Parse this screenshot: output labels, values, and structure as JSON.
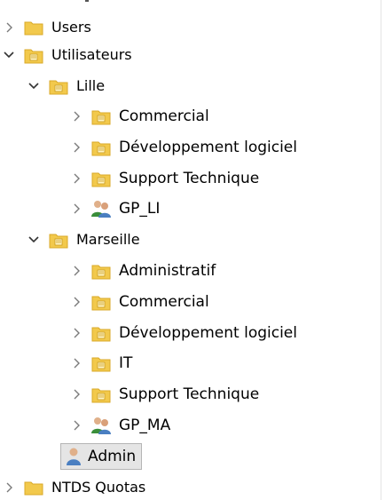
{
  "tree": {
    "items": [
      {
        "label": "Users",
        "expanded": false,
        "icon": "folder-icon",
        "level": 0
      },
      {
        "label": "Utilisateurs",
        "expanded": true,
        "icon": "ou-folder-icon",
        "level": 0
      },
      {
        "label": "Lille",
        "expanded": true,
        "icon": "ou-folder-icon",
        "level": 1
      },
      {
        "label": "Commercial",
        "expanded": false,
        "icon": "ou-folder-icon",
        "level": 2
      },
      {
        "label": "Développement logiciel",
        "expanded": false,
        "icon": "ou-folder-icon",
        "level": 2
      },
      {
        "label": "Support Technique",
        "expanded": false,
        "icon": "ou-folder-icon",
        "level": 2
      },
      {
        "label": "GP_LI",
        "expanded": false,
        "icon": "group-icon",
        "level": 2
      },
      {
        "label": "Marseille",
        "expanded": true,
        "icon": "ou-folder-icon",
        "level": 1
      },
      {
        "label": "Administratif",
        "expanded": false,
        "icon": "ou-folder-icon",
        "level": 2
      },
      {
        "label": "Commercial",
        "expanded": false,
        "icon": "ou-folder-icon",
        "level": 2
      },
      {
        "label": "Développement logiciel",
        "expanded": false,
        "icon": "ou-folder-icon",
        "level": 2
      },
      {
        "label": "IT",
        "expanded": false,
        "icon": "ou-folder-icon",
        "level": 2
      },
      {
        "label": "Support Technique",
        "expanded": false,
        "icon": "ou-folder-icon",
        "level": 2
      },
      {
        "label": "GP_MA",
        "expanded": false,
        "icon": "group-icon",
        "level": 2
      },
      {
        "label": "Admin",
        "expanded": null,
        "icon": "user-icon",
        "level": 1,
        "selected": true
      },
      {
        "label": "NTDS Quotas",
        "expanded": false,
        "icon": "folder-icon",
        "level": 0
      }
    ]
  },
  "colors": {
    "folder": "#f2c94c",
    "folder_dark": "#d9a928",
    "selection_bg": "#e5e5e5",
    "selection_border": "#b5b5b5",
    "chevron": "#7a7a7a"
  }
}
